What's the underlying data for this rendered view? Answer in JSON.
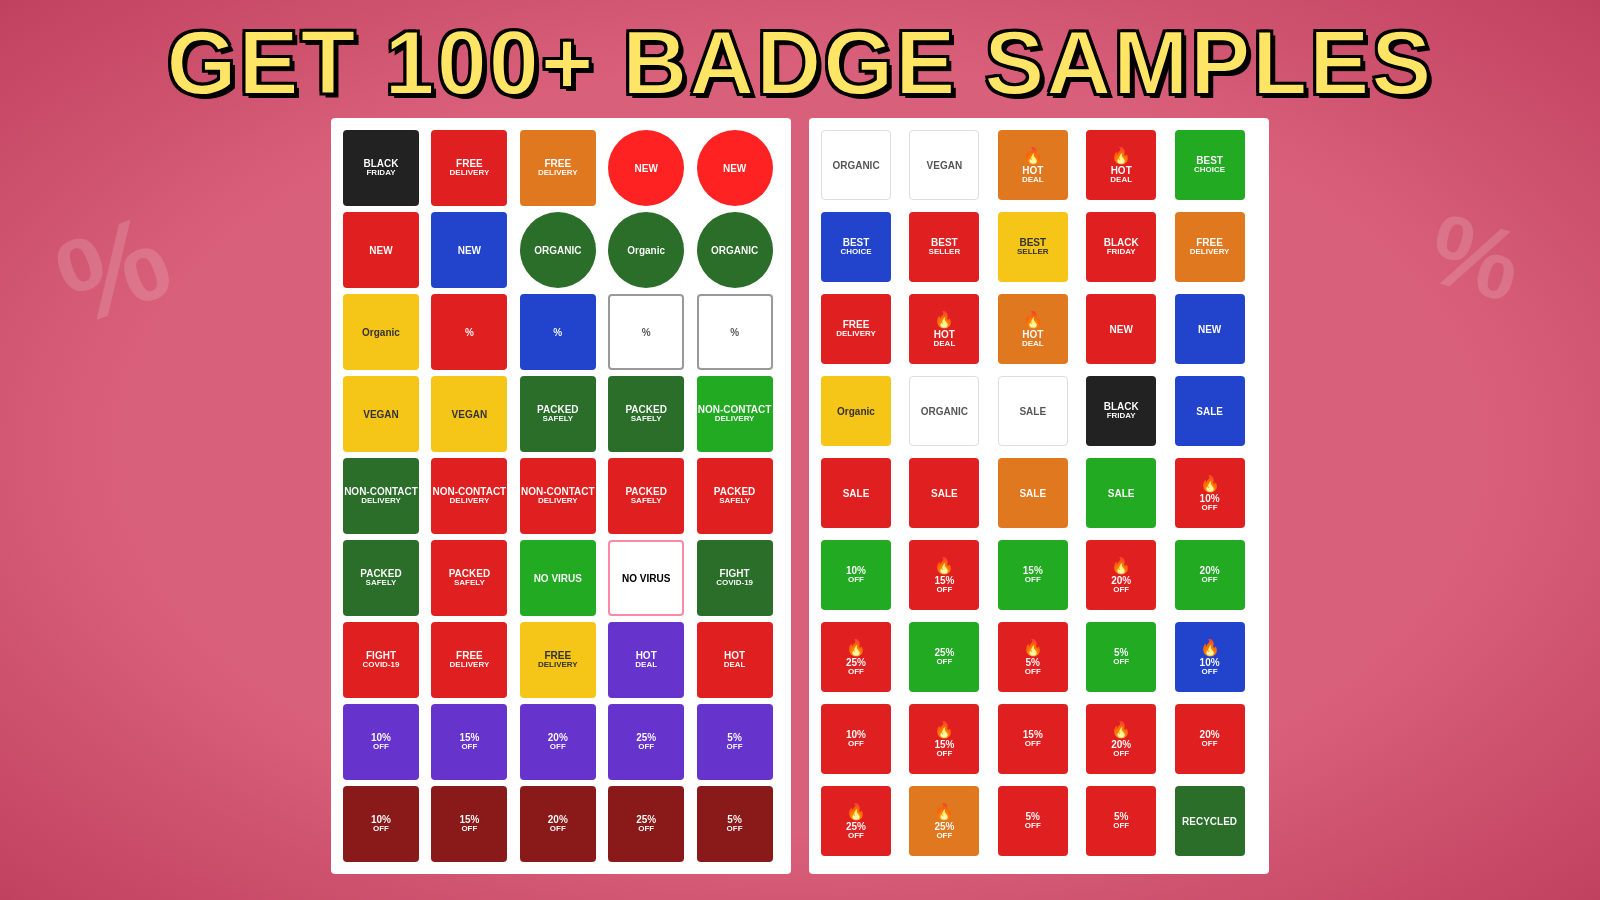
{
  "header": {
    "title": "GET 100+ BADGE SAMPLES"
  },
  "left_panel": {
    "badges": [
      {
        "id": "black-friday",
        "label": "BLACK FRIDAY",
        "style": "b-black",
        "line1": "BLACK",
        "line2": "FRIDAY"
      },
      {
        "id": "free-delivery-red",
        "label": "FREE DELIVERY",
        "style": "b-red",
        "line1": "FREE",
        "line2": "DELIVERY"
      },
      {
        "id": "free-delivery-orange",
        "label": "FREE DELIVERY",
        "style": "b-orange",
        "line1": "FREE",
        "line2": "DELIVERY"
      },
      {
        "id": "new-red-circle1",
        "label": "NEW",
        "style": "b-circle-red",
        "line1": "NEW"
      },
      {
        "id": "new-red-circle2",
        "label": "NEW",
        "style": "b-circle-red",
        "line1": "NEW"
      },
      {
        "id": "new-red-badge",
        "label": "NEW",
        "style": "b-red",
        "line1": "NEW"
      },
      {
        "id": "new-blue-badge",
        "label": "NEW",
        "style": "b-blue",
        "line1": "NEW"
      },
      {
        "id": "organic-circle1",
        "label": "ORGANIC",
        "style": "b-dark-green",
        "line1": "ORGANIC"
      },
      {
        "id": "organic-circle2",
        "label": "Organic",
        "style": "b-dark-green",
        "line1": "Organic"
      },
      {
        "id": "organic-circle3",
        "label": "ORGANIC",
        "style": "b-dark-green",
        "line1": "ORGANIC"
      },
      {
        "id": "organic-yellow",
        "label": "Organic",
        "style": "b-yellow-sq",
        "line1": "Organic"
      },
      {
        "id": "percent-red",
        "label": "%",
        "style": "b-red",
        "line1": "%"
      },
      {
        "id": "percent-blue",
        "label": "%",
        "style": "b-blue",
        "line1": "%"
      },
      {
        "id": "percent-outline",
        "label": "%",
        "style": "b-outline",
        "line1": "%"
      },
      {
        "id": "percent-outline2",
        "label": "%",
        "style": "b-outline",
        "line1": "%"
      },
      {
        "id": "vegan-yellow",
        "label": "VEGAN",
        "style": "b-yellow-sq",
        "line1": "VEGAN"
      },
      {
        "id": "vegan-green",
        "label": "VEGAN",
        "style": "b-yellow-sq",
        "line1": "VEGAN"
      },
      {
        "id": "packed-safely-green1",
        "label": "PACKED SAFELY",
        "style": "b-dark-green-sq",
        "line1": "PACKED",
        "line2": "SAFELY"
      },
      {
        "id": "packed-safely-green2",
        "label": "PACKED SAFELY",
        "style": "b-dark-green-sq",
        "line1": "PACKED",
        "line2": "SAFELY"
      },
      {
        "id": "non-contact-delivery-green",
        "label": "NON-CONTACT DELIVERY",
        "style": "b-green",
        "line1": "NON-CONTACT",
        "line2": "DELIVERY"
      },
      {
        "id": "non-contact-delivery-green2",
        "label": "NON-CONTACT DELIVERY",
        "style": "b-dark-green-sq",
        "line1": "NON-CONTACT",
        "line2": "DELIVERY"
      },
      {
        "id": "non-contact-delivery-red",
        "label": "NON-CONTACT DELIVERY",
        "style": "b-red",
        "line1": "NON-CONTACT",
        "line2": "DELIVERY"
      },
      {
        "id": "non-contact-delivery-red2",
        "label": "NON-CONTACT DELIVERY",
        "style": "b-red",
        "line1": "NON-CONTACT",
        "line2": "DELIVERY"
      },
      {
        "id": "packed-safely-red",
        "label": "PACKED SAFELY",
        "style": "b-red",
        "line1": "PACKED",
        "line2": "SAFELY"
      },
      {
        "id": "packed-safely-pink",
        "label": "PACKED SAFELY",
        "style": "b-red",
        "line1": "PACKED",
        "line2": "SAFELY"
      },
      {
        "id": "packed-safely-dark-green",
        "label": "PACKED SAFELY",
        "style": "b-dark-green-sq",
        "line1": "PACKED",
        "line2": "SAFELY"
      },
      {
        "id": "packed-safely-red2",
        "label": "PACKED SAFELY",
        "style": "b-red",
        "line1": "PACKED",
        "line2": "SAFELY"
      },
      {
        "id": "no-virus",
        "label": "NO VIRUS",
        "style": "b-green",
        "line1": "NO VIRUS"
      },
      {
        "id": "no-virus2",
        "label": "NO VIRUS",
        "style": "b-pink-outline",
        "line1": "NO VIRUS"
      },
      {
        "id": "fight-covid",
        "label": "FIGHT COVID-19",
        "style": "b-dark-green-sq",
        "line1": "FIGHT",
        "line2": "COVID-19"
      },
      {
        "id": "fight-covid2",
        "label": "FIGHT COVID-19",
        "style": "b-red",
        "line1": "FIGHT",
        "line2": "COVID-19"
      },
      {
        "id": "free-delivery2",
        "label": "FREE DELIVERY",
        "style": "b-red",
        "line1": "FREE",
        "line2": "DELIVERY"
      },
      {
        "id": "free-delivery-yellow",
        "label": "FREE DELIVERY",
        "style": "b-yellow-sq",
        "line1": "FREE",
        "line2": "DELIVERY"
      },
      {
        "id": "hot-deal-purple",
        "label": "HOT DEAL",
        "style": "b-purple",
        "line1": "HOT",
        "line2": "DEAL"
      },
      {
        "id": "hot-deal-red",
        "label": "HOT DEAL",
        "style": "b-red",
        "line1": "HOT",
        "line2": "DEAL"
      },
      {
        "id": "10off-purple",
        "label": "10% OFF",
        "style": "b-purple",
        "line1": "10%",
        "line2": "OFF"
      },
      {
        "id": "15off-purple",
        "label": "15% OFF",
        "style": "b-purple",
        "line1": "15%",
        "line2": "OFF"
      },
      {
        "id": "20off-purple",
        "label": "20% OFF",
        "style": "b-purple",
        "line1": "20%",
        "line2": "OFF"
      },
      {
        "id": "25off-purple",
        "label": "25% OFF",
        "style": "b-purple",
        "line1": "25%",
        "line2": "OFF"
      },
      {
        "id": "5off-purple",
        "label": "5% OFF",
        "style": "b-purple",
        "line1": "5%",
        "line2": "OFF"
      },
      {
        "id": "10off-maroon",
        "label": "10% OFF",
        "style": "b-maroon",
        "line1": "10%",
        "line2": "OFF"
      },
      {
        "id": "15off-maroon",
        "label": "15% OFF",
        "style": "b-maroon",
        "line1": "15%",
        "line2": "OFF"
      },
      {
        "id": "20off-maroon",
        "label": "20% OFF",
        "style": "b-maroon",
        "line1": "20%",
        "line2": "OFF"
      },
      {
        "id": "25off-maroon",
        "label": "25% OFF",
        "style": "b-maroon",
        "line1": "25%",
        "line2": "OFF"
      },
      {
        "id": "5off-maroon",
        "label": "5% OFF",
        "style": "b-maroon",
        "line1": "5%",
        "line2": "OFF"
      }
    ]
  },
  "right_panel": {
    "badges": [
      {
        "id": "organic-white",
        "label": "ORGANIC",
        "style": "b-white",
        "line1": "ORGANIC"
      },
      {
        "id": "vegan-white",
        "label": "VEGAN",
        "style": "b-white",
        "line1": "VEGAN"
      },
      {
        "id": "hot-deal-orange",
        "label": "HOT DEAL",
        "style": "b-orange",
        "line1": "HOT",
        "line2": "DEAL",
        "emoji": "🔥"
      },
      {
        "id": "hot-deal-red2",
        "label": "HOT DEAL",
        "style": "b-red",
        "line1": "HOT",
        "line2": "DEAL",
        "emoji": "🔥"
      },
      {
        "id": "best-choice",
        "label": "BEST CHOICE",
        "style": "b-green",
        "line1": "BEST",
        "line2": "CHOICE"
      },
      {
        "id": "best-choice-blue",
        "label": "BEST CHOICE",
        "style": "b-blue",
        "line1": "BEST",
        "line2": "CHOICE"
      },
      {
        "id": "best-seller",
        "label": "BEST SELLER",
        "style": "b-red",
        "line1": "BEST",
        "line2": "SELLER"
      },
      {
        "id": "best-seller2",
        "label": "BEST SELLER",
        "style": "b-yellow-sq",
        "line1": "BEST",
        "line2": "SELLER"
      },
      {
        "id": "black-friday2",
        "label": "BLACK FRIDAY",
        "style": "b-red",
        "line1": "BLACK",
        "line2": "FRIDAY"
      },
      {
        "id": "free-delivery3",
        "label": "FREE DELIVERY",
        "style": "b-orange",
        "line1": "FREE",
        "line2": "DELIVERY"
      },
      {
        "id": "free-delivery4",
        "label": "FREE DELIVERY",
        "style": "b-red",
        "line1": "FREE",
        "line2": "DELIVERY"
      },
      {
        "id": "hot-deal3",
        "label": "HOT DEAL",
        "style": "b-red",
        "line1": "HOT",
        "line2": "DEAL",
        "emoji": "🔥"
      },
      {
        "id": "hot-deal4",
        "label": "HOT DEAL",
        "style": "b-orange",
        "line1": "HOT",
        "line2": "DEAL",
        "emoji": "🔥"
      },
      {
        "id": "new-red2",
        "label": "NEW",
        "style": "b-red",
        "line1": "NEW"
      },
      {
        "id": "new-blue2",
        "label": "NEW",
        "style": "b-blue",
        "line1": "NEW"
      },
      {
        "id": "organic2",
        "label": "Organic",
        "style": "b-yellow-sq",
        "line1": "Organic"
      },
      {
        "id": "organic-white2",
        "label": "ORGANIC",
        "style": "b-white",
        "line1": "ORGANIC"
      },
      {
        "id": "sale-white",
        "label": "SALE",
        "style": "b-white",
        "line1": "SALE"
      },
      {
        "id": "black-friday3",
        "label": "BLACK FRIDAY",
        "style": "b-black",
        "line1": "BLACK",
        "line2": "FRIDAY"
      },
      {
        "id": "sale-blue",
        "label": "SALE",
        "style": "b-blue",
        "line1": "SALE"
      },
      {
        "id": "sale1",
        "label": "SALE",
        "style": "b-red",
        "line1": "SALE"
      },
      {
        "id": "sale2",
        "label": "SALE",
        "style": "b-red",
        "line1": "SALE"
      },
      {
        "id": "sale3",
        "label": "SALE",
        "style": "b-orange",
        "line1": "SALE"
      },
      {
        "id": "sale4",
        "label": "SALE",
        "style": "b-green",
        "line1": "SALE"
      },
      {
        "id": "10off2",
        "label": "10% OFF",
        "style": "b-red",
        "line1": "10%",
        "line2": "OFF",
        "emoji": "🔥"
      },
      {
        "id": "10off-green",
        "label": "10% OFF",
        "style": "b-green",
        "line1": "10%",
        "line2": "OFF"
      },
      {
        "id": "15off-green",
        "label": "15% OFF",
        "style": "b-red",
        "line1": "15%",
        "line2": "OFF",
        "emoji": "🔥"
      },
      {
        "id": "15off-green2",
        "label": "15% OFF",
        "style": "b-green",
        "line1": "15%",
        "line2": "OFF"
      },
      {
        "id": "20off-red",
        "label": "20% OFF",
        "style": "b-red",
        "line1": "20%",
        "line2": "OFF",
        "emoji": "🔥"
      },
      {
        "id": "20off-green",
        "label": "20% OFF",
        "style": "b-green",
        "line1": "20%",
        "line2": "OFF"
      },
      {
        "id": "25off-red",
        "label": "25% OFF",
        "style": "b-red",
        "line1": "25%",
        "line2": "OFF",
        "emoji": "🔥"
      },
      {
        "id": "25off-green",
        "label": "25% OFF",
        "style": "b-green",
        "line1": "25%",
        "line2": "OFF"
      },
      {
        "id": "5off-red",
        "label": "5% OFF",
        "style": "b-red",
        "line1": "5%",
        "line2": "OFF",
        "emoji": "🔥"
      },
      {
        "id": "5off-green",
        "label": "5% OFF",
        "style": "b-green",
        "line1": "5%",
        "line2": "OFF"
      },
      {
        "id": "10off-red2",
        "label": "10% OFF",
        "style": "b-blue",
        "line1": "10%",
        "line2": "OFF",
        "emoji": "🔥"
      },
      {
        "id": "10off-red3",
        "label": "10% OFF",
        "style": "b-red",
        "line1": "10%",
        "line2": "OFF"
      },
      {
        "id": "15off-red2",
        "label": "15% OFF",
        "style": "b-red",
        "line1": "15%",
        "line2": "OFF",
        "emoji": "🔥"
      },
      {
        "id": "15off-red3",
        "label": "15% OFF",
        "style": "b-red",
        "line1": "15%",
        "line2": "OFF"
      },
      {
        "id": "20off-red2",
        "label": "20% OFF",
        "style": "b-red",
        "line1": "20%",
        "line2": "OFF",
        "emoji": "🔥"
      },
      {
        "id": "20off-red3",
        "label": "20% OFF",
        "style": "b-red",
        "line1": "20%",
        "line2": "OFF"
      },
      {
        "id": "25off-fire",
        "label": "25% OFF",
        "style": "b-red",
        "line1": "25%",
        "line2": "OFF",
        "emoji": "🔥"
      },
      {
        "id": "25off-fire2",
        "label": "25% OFF",
        "style": "b-orange",
        "line1": "25%",
        "line2": "OFF",
        "emoji": "🔥"
      },
      {
        "id": "5off-fire",
        "label": "5% OFF",
        "style": "b-red",
        "line1": "5%",
        "line2": "OFF"
      },
      {
        "id": "5off-fire2",
        "label": "5% OFF",
        "style": "b-red",
        "line1": "5%",
        "line2": "OFF"
      },
      {
        "id": "recycled",
        "label": "RECYCLED",
        "style": "b-dark-green-sq",
        "line1": "RECYCLED"
      }
    ]
  }
}
